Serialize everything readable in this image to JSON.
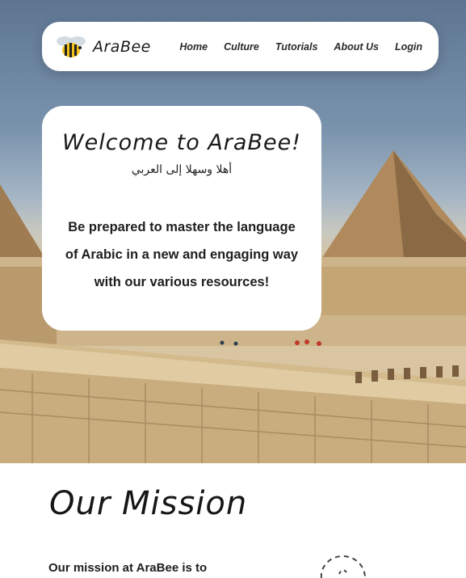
{
  "nav": {
    "brand": "AraBee",
    "links": [
      "Home",
      "Culture",
      "Tutorials",
      "About Us",
      "Login"
    ]
  },
  "hero": {
    "title": "Welcome to AraBee!",
    "arabic": "أهلا وسهلا إلى العربي",
    "body": "Be prepared to master the language of Arabic in a new and engaging way with our various resources!"
  },
  "mission": {
    "title": "Our Mission",
    "text": "Our mission at AraBee is to"
  },
  "colors": {
    "bee_yellow": "#f2c21b",
    "text_dark": "#1e1e1e",
    "card_bg": "#ffffff"
  },
  "icons": {
    "logo": "bee-icon",
    "mission_art": "dashed-loop-doodle"
  }
}
